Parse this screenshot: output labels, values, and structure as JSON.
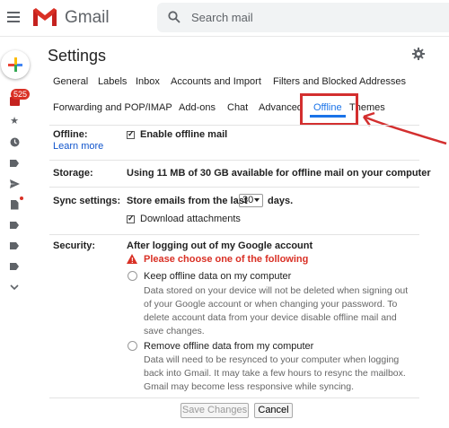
{
  "app": {
    "name": "Gmail"
  },
  "search": {
    "placeholder": "Search mail"
  },
  "rail": {
    "inbox_count": "525"
  },
  "settings": {
    "title": "Settings",
    "tabs": [
      {
        "label": "General"
      },
      {
        "label": "Labels"
      },
      {
        "label": "Inbox"
      },
      {
        "label": "Accounts and Import"
      },
      {
        "label": "Filters and Blocked Addresses"
      },
      {
        "label": "Forwarding and POP/IMAP"
      },
      {
        "label": "Add-ons"
      },
      {
        "label": "Chat"
      },
      {
        "label": "Advanced"
      },
      {
        "label": "Offline"
      },
      {
        "label": "Themes"
      }
    ],
    "active_tab": "Offline"
  },
  "offline": {
    "label": "Offline:",
    "learn_more": "Learn more",
    "enable_label": "Enable offline mail",
    "enable_checked": true
  },
  "storage": {
    "label": "Storage:",
    "text": "Using 11 MB of 30 GB available for offline mail on your computer"
  },
  "sync": {
    "label": "Sync settings:",
    "prefix": "Store emails from the last",
    "days_value": "30",
    "suffix": "days.",
    "download_label": "Download attachments",
    "download_checked": true
  },
  "security": {
    "label": "Security:",
    "heading": "After logging out of my Google account",
    "warning": "Please choose one of the following",
    "options": [
      {
        "title": "Keep offline data on my computer",
        "lines": [
          "Data stored on your device will not be deleted when signing out",
          "of your Google account or when changing your password. To",
          "delete account data from your device disable offline mail and",
          "save changes."
        ]
      },
      {
        "title": "Remove offline data from my computer",
        "lines": [
          "Data will need to be resynced to your computer when logging",
          "back into Gmail. It may take a few hours to resync the mailbox.",
          "Gmail may become less responsive while syncing."
        ]
      }
    ]
  },
  "buttons": {
    "save": "Save Changes",
    "cancel": "Cancel"
  },
  "colors": {
    "highlight": "#d32f2f",
    "accent": "#1a73e8",
    "warning": "#d93025"
  }
}
